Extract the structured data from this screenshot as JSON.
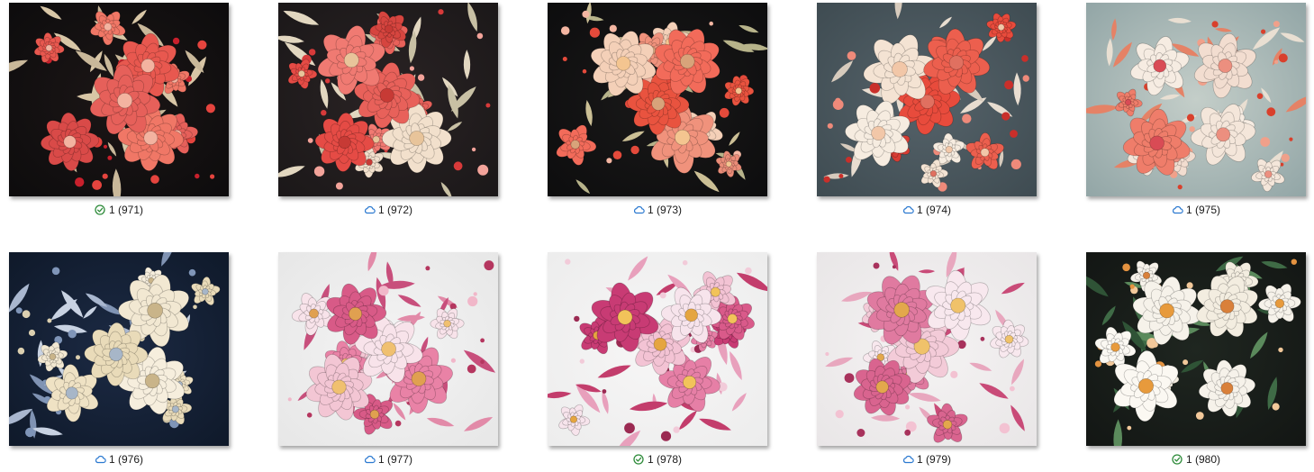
{
  "files": [
    {
      "name": "1 (971)",
      "status": "available-locally",
      "status_icon": "check-circle-icon",
      "theme": "red-carnation-dark"
    },
    {
      "name": "1 (972)",
      "status": "online-only",
      "status_icon": "cloud-icon",
      "theme": "red-roses-dark"
    },
    {
      "name": "1 (973)",
      "status": "online-only",
      "status_icon": "cloud-icon",
      "theme": "coral-peony-black"
    },
    {
      "name": "1 (974)",
      "status": "online-only",
      "status_icon": "cloud-icon",
      "theme": "red-cream-slate"
    },
    {
      "name": "1 (975)",
      "status": "online-only",
      "status_icon": "cloud-icon",
      "theme": "orchid-sage"
    },
    {
      "name": "1 (976)",
      "status": "online-only",
      "status_icon": "cloud-icon",
      "theme": "cream-peony-navy"
    },
    {
      "name": "1 (977)",
      "status": "online-only",
      "status_icon": "cloud-icon",
      "theme": "pink-orchid-white"
    },
    {
      "name": "1 (978)",
      "status": "available-locally",
      "status_icon": "check-circle-icon",
      "theme": "magenta-orchid-white"
    },
    {
      "name": "1 (979)",
      "status": "online-only",
      "status_icon": "cloud-icon",
      "theme": "pink-orchid-soft"
    },
    {
      "name": "1 (980)",
      "status": "available-locally",
      "status_icon": "check-circle-icon",
      "theme": "white-lily-dark"
    }
  ],
  "colors": {
    "cloud_icon": "#2b79d0",
    "check_icon": "#2e8b3a",
    "caption_text": "#1a1a1a"
  }
}
